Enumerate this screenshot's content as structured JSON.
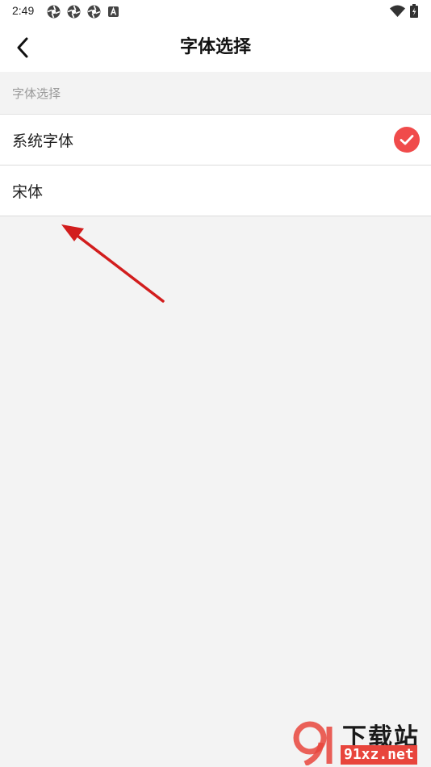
{
  "status_bar": {
    "time": "2:49",
    "icons": [
      "app-notification-icon",
      "app-notification-icon",
      "app-notification-icon",
      "font-app-icon"
    ],
    "right_icons": [
      "wifi-icon",
      "battery-icon"
    ]
  },
  "app_bar": {
    "title": "字体选择",
    "back_icon": "chevron-left-icon"
  },
  "section": {
    "label": "字体选择"
  },
  "font_options": [
    {
      "label": "系统字体",
      "selected": true
    },
    {
      "label": "宋体",
      "selected": false
    }
  ],
  "colors": {
    "accent": "#f04b4b",
    "annotation_arrow": "#d21d1d",
    "background": "#f3f3f3"
  },
  "watermark": {
    "logo_text": "下载站",
    "domain": "91xz.net"
  }
}
